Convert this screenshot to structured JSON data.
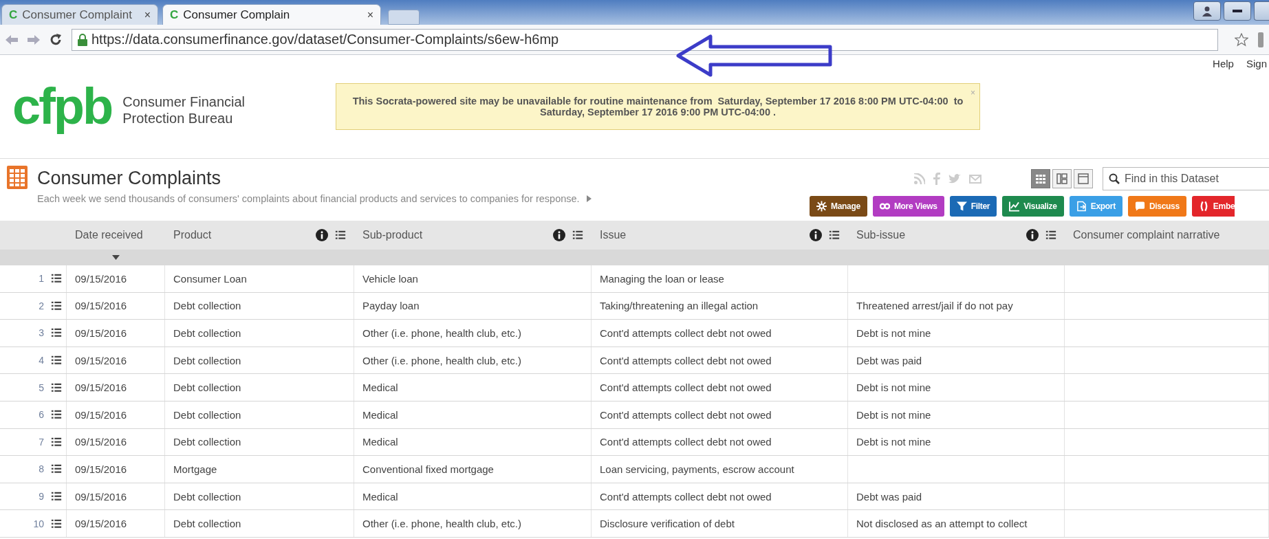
{
  "browser": {
    "tabs": [
      {
        "favicon": "C",
        "title": "Consumer Complaint",
        "close": "×",
        "selected": false
      },
      {
        "favicon": "C",
        "title": "Consumer Complain",
        "close": "×",
        "selected": true
      }
    ],
    "url": "https://data.consumerfinance.gov/dataset/Consumer-Complaints/s6ew-h6mp"
  },
  "site": {
    "logo": "cfpb",
    "name_lines": [
      "Consumer Financial",
      "Protection Bureau"
    ],
    "notice": "This Socrata-powered site may be unavailable for routine maintenance from  Saturday, September 17 2016 8:00 PM UTC-04:00  to  Saturday, September 17 2016 9:00 PM UTC-04:00 .",
    "notice_close": "×",
    "links": [
      "Help",
      "Sign"
    ]
  },
  "dataset": {
    "title": "Consumer Complaints",
    "description": "Each week we send thousands of consumers' complaints about financial products and services to companies for response.",
    "view_modes": [
      {
        "selected": true
      },
      {
        "selected": false
      },
      {
        "selected": false
      }
    ],
    "search": {
      "placeholder": "Find in this Dataset"
    },
    "actions": [
      {
        "kind": "manage",
        "label": "Manage",
        "color": "#7a4a16"
      },
      {
        "kind": "views",
        "label": "More Views",
        "color": "#b23cc2"
      },
      {
        "kind": "filter",
        "label": "Filter",
        "color": "#1b6ab5"
      },
      {
        "kind": "visualize",
        "label": "Visualize",
        "color": "#1e8a4e"
      },
      {
        "kind": "export",
        "label": "Export",
        "color": "#3a9fe6"
      },
      {
        "kind": "discuss",
        "label": "Discuss",
        "color": "#f07818"
      },
      {
        "kind": "embed",
        "label": "Embe",
        "color": "#e3262b"
      }
    ]
  },
  "table": {
    "columns": [
      {
        "label": "Date received",
        "sorted": true,
        "menu": false
      },
      {
        "label": "Product",
        "sorted": false,
        "menu": true
      },
      {
        "label": "Sub-product",
        "sorted": false,
        "menu": true
      },
      {
        "label": "Issue",
        "sorted": false,
        "menu": true
      },
      {
        "label": "Sub-issue",
        "sorted": false,
        "menu": true
      },
      {
        "label": "Consumer complaint narrative",
        "sorted": false,
        "menu": false
      }
    ],
    "rows": [
      {
        "number": "1",
        "cells": [
          "09/15/2016",
          "Consumer Loan",
          "Vehicle loan",
          "Managing the loan or lease"
        ]
      },
      {
        "number": "2",
        "cells": [
          "09/15/2016",
          "Debt collection",
          "Payday loan",
          "Taking/threatening an illegal action",
          "Threatened arrest/jail if do not pay"
        ]
      },
      {
        "number": "3",
        "cells": [
          "09/15/2016",
          "Debt collection",
          "Other (i.e. phone, health club, etc.)",
          "Cont'd attempts collect debt not owed",
          "Debt is not mine"
        ]
      },
      {
        "number": "4",
        "cells": [
          "09/15/2016",
          "Debt collection",
          "Other (i.e. phone, health club, etc.)",
          "Cont'd attempts collect debt not owed",
          "Debt was paid"
        ]
      },
      {
        "number": "5",
        "cells": [
          "09/15/2016",
          "Debt collection",
          "Medical",
          "Cont'd attempts collect debt not owed",
          "Debt is not mine"
        ]
      },
      {
        "number": "6",
        "cells": [
          "09/15/2016",
          "Debt collection",
          "Medical",
          "Cont'd attempts collect debt not owed",
          "Debt is not mine"
        ]
      },
      {
        "number": "7",
        "cells": [
          "09/15/2016",
          "Debt collection",
          "Medical",
          "Cont'd attempts collect debt not owed",
          "Debt is not mine"
        ]
      },
      {
        "number": "8",
        "cells": [
          "09/15/2016",
          "Mortgage",
          "Conventional fixed mortgage",
          "Loan servicing, payments, escrow account"
        ]
      },
      {
        "number": "9",
        "cells": [
          "09/15/2016",
          "Debt collection",
          "Medical",
          "Cont'd attempts collect debt not owed",
          "Debt was paid"
        ]
      },
      {
        "number": "10",
        "cells": [
          "09/15/2016",
          "Debt collection",
          "Other (i.e. phone, health club, etc.)",
          "Disclosure verification of debt",
          "Not disclosed as an attempt to collect"
        ]
      }
    ]
  }
}
